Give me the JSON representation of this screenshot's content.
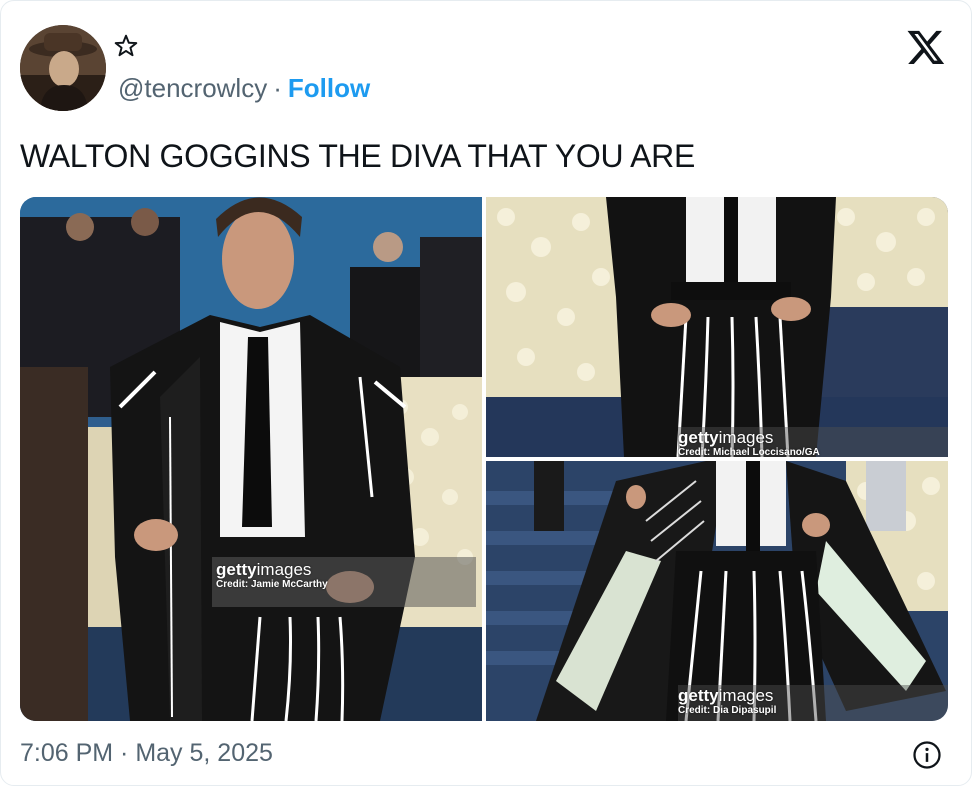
{
  "author": {
    "handle": "@tencrowlcy",
    "separator": "·",
    "follow_label": "Follow",
    "avatar_icon": "user-avatar",
    "badge_icon": "star-outline-icon"
  },
  "tweet": {
    "text": "WALTON GOGGINS THE DIVA THAT YOU ARE",
    "timestamp": "7:06 PM · May 5, 2025"
  },
  "media": [
    {
      "watermark_brand_bold": "getty",
      "watermark_brand_light": "images",
      "credit": "Credit: Jamie McCarthy"
    },
    {
      "watermark_brand_bold": "getty",
      "watermark_brand_light": "images",
      "credit": "Credit: Michael Loccisano/GA"
    },
    {
      "watermark_brand_bold": "getty",
      "watermark_brand_light": "images",
      "credit": "Credit: Dia Dipasupil"
    }
  ],
  "icons": {
    "platform": "x-logo-icon",
    "info": "info-icon"
  },
  "colors": {
    "accent": "#1d9bf0",
    "secondary_text": "#536471",
    "primary_text": "#0f1419"
  }
}
